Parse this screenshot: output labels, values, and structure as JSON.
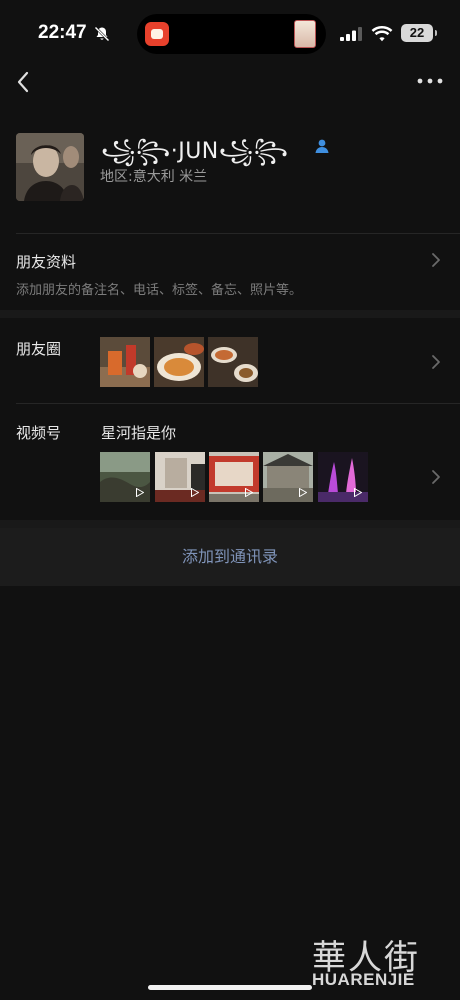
{
  "status_bar": {
    "time": "22:47",
    "battery": "22"
  },
  "profile": {
    "nickname": "꧁꧂·JUN꧁꧂",
    "region_label": "地区:",
    "region_value": "意大利 米兰"
  },
  "friend_info": {
    "title": "朋友资料",
    "subtitle": "添加朋友的备注名、电话、标签、备忘、照片等。"
  },
  "moments": {
    "title": "朋友圈",
    "photo_count": 3
  },
  "channels": {
    "title": "视频号",
    "channel_name": "星河指是你",
    "video_count": 5
  },
  "actions": {
    "add_contact": "添加到通讯录"
  },
  "watermark": {
    "han": "華人街",
    "latin": "HUARENJIE"
  },
  "colors": {
    "background": "#111111",
    "link": "#7f93b8",
    "person_icon": "#3f8fe0"
  },
  "icons": [
    "back-icon",
    "more-icon",
    "bell-off-icon",
    "signal-icon",
    "wifi-icon",
    "person-icon",
    "chevron-right-icon",
    "play-icon"
  ]
}
